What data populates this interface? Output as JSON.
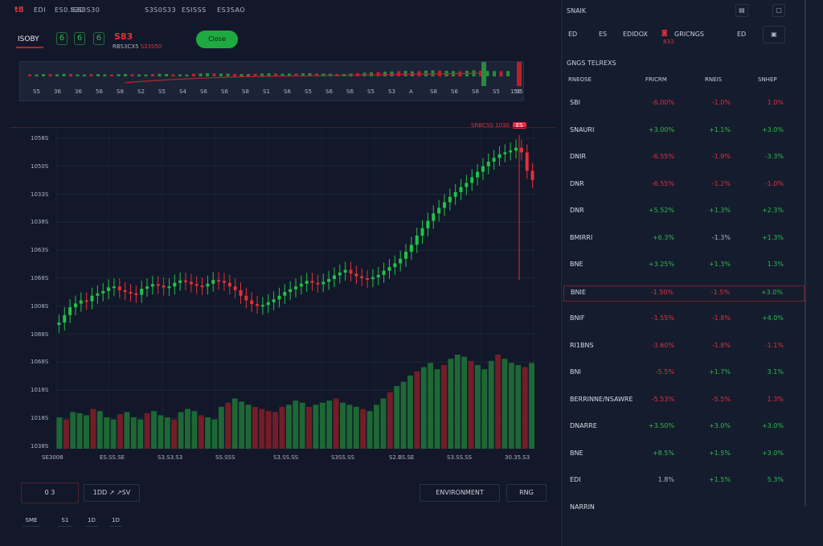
{
  "topbar": {
    "logo": "t8",
    "menu": [
      "EDI",
      "ES0.S30",
      "ISS3S30",
      "S3S0S33",
      "ESISSS",
      "ES3SAO"
    ]
  },
  "ticker": {
    "symbol": "ISOBY",
    "chips": [
      "6",
      "6",
      "6"
    ],
    "price": "S83",
    "sub_a": "RBS3CX5",
    "sub_b": "S33S50",
    "green_button": "Close"
  },
  "navigator": {
    "ticks": [
      "S5",
      "36",
      "36",
      "56",
      "S8",
      "S2",
      "S5",
      "S4",
      "S6",
      "S6",
      "S8",
      "S1",
      "S6",
      "S5",
      "S6",
      "S6",
      "S5",
      "S3",
      "A",
      "S8",
      "S6",
      "S8",
      "S5",
      "50"
    ],
    "end_label": "1.05"
  },
  "chart": {
    "live_label": "SRBCSS 1030",
    "live_badge": "ES",
    "y_labels": [
      "1058S",
      "1050S",
      "1033S",
      "1038S",
      "1063S",
      "1068S",
      "1008S",
      "1088S",
      "1068S",
      "1018S",
      "1018S",
      "1038S"
    ],
    "x_labels": [
      "SE3008",
      "ES.SS.SE",
      "S3.S3.S3",
      "SS.SSS",
      "S3.SS.SS",
      "S3SS.SS",
      "S2.BS.SE",
      "S3.SS.SS",
      "30.35.S3"
    ]
  },
  "chart_data": {
    "type": "candlestick",
    "series": [
      {
        "name": "price",
        "values": [
          392,
          408,
          425,
          433,
          440,
          438,
          450,
          455,
          460,
          468,
          470,
          462,
          458,
          455,
          452,
          465,
          470,
          475,
          472,
          468,
          470,
          478,
          483,
          480,
          475,
          472,
          470,
          476,
          484,
          482,
          478,
          470,
          462,
          450,
          440,
          432,
          428,
          430,
          436,
          442,
          450,
          458,
          464,
          470,
          476,
          482,
          478,
          475,
          480,
          486,
          494,
          500,
          506,
          498,
          492,
          488,
          486,
          490,
          495,
          504,
          512,
          520,
          530,
          545,
          560,
          580,
          596,
          612,
          628,
          640,
          652,
          664,
          674,
          685,
          694,
          706,
          718,
          730,
          740,
          748,
          756,
          760,
          764,
          770,
          760,
          720,
          700
        ]
      }
    ],
    "volume": [
      30,
      28,
      35,
      34,
      32,
      38,
      36,
      30,
      28,
      33,
      35,
      30,
      28,
      34,
      36,
      32,
      30,
      28,
      35,
      38,
      36,
      32,
      30,
      28,
      40,
      44,
      48,
      45,
      42,
      40,
      38,
      36,
      35,
      40,
      42,
      46,
      44,
      40,
      42,
      44,
      46,
      48,
      44,
      42,
      40,
      38,
      36,
      42,
      48,
      54,
      60,
      64,
      70,
      74,
      78,
      82,
      76,
      80,
      86,
      90,
      88,
      84,
      80,
      76,
      84,
      90,
      86,
      82,
      80,
      78,
      82
    ]
  },
  "controls": {
    "left_box": "0   3",
    "range_box": "1DD ↗ ↗SV",
    "tabs": [
      "SME",
      "S1",
      "1D",
      "1D"
    ],
    "right_wide": "ENVIRONMENT",
    "right_small": "RNG"
  },
  "sidebar": {
    "top_label": "SNAIK",
    "filters": [
      "ED",
      "ES",
      "EDIDOX"
    ],
    "badge_label": "GRICNGS",
    "badge_sub": "833",
    "extra": "ED",
    "section": "GNGS TELREXS",
    "cols": [
      "RNEOSE",
      "FRICRM",
      "RNEIS",
      "SNHEP"
    ],
    "rows": [
      {
        "n": "SBI",
        "p": "-6.00%",
        "c": "-1.0%",
        "v": "1.0%",
        "pc": "red",
        "cc": "red",
        "vc": "red"
      },
      {
        "n": "SNAURI",
        "p": "+3.00%",
        "c": "+1.1%",
        "v": "+3.0%",
        "pc": "green",
        "cc": "green",
        "vc": "green"
      },
      {
        "n": "DNIR",
        "p": "-6.55%",
        "c": "-1.9%",
        "v": "-3.3%",
        "pc": "red",
        "cc": "red",
        "vc": "green"
      },
      {
        "n": "DNR",
        "p": "-6.55%",
        "c": "-1.2%",
        "v": "-1.0%",
        "pc": "red",
        "cc": "red",
        "vc": "red"
      },
      {
        "n": "DNR",
        "p": "+5.52%",
        "c": "+1.3%",
        "v": "+2.3%",
        "pc": "green",
        "cc": "green",
        "vc": "green"
      },
      {
        "n": "BMIRRI",
        "p": "+6.3%",
        "c": "-1.3%",
        "v": "+1.3%",
        "pc": "green",
        "cc": "dim",
        "vc": "green"
      },
      {
        "n": "BNE",
        "p": "+3.25%",
        "c": "+1.3%",
        "v": "1.3%",
        "pc": "green",
        "cc": "green",
        "vc": "green"
      },
      {
        "n": "BNIE",
        "p": "-1.50%",
        "c": "-1.5%",
        "v": "+3.0%",
        "pc": "red",
        "cc": "red",
        "vc": "green"
      },
      {
        "n": "BNIF",
        "p": "-1.55%",
        "c": "-1.8%",
        "v": "+4.0%",
        "pc": "red",
        "cc": "red",
        "vc": "green"
      },
      {
        "n": "RI1BNS",
        "p": "-3.60%",
        "c": "-1.8%",
        "v": "-1.1%",
        "pc": "red",
        "cc": "red",
        "vc": "red"
      },
      {
        "n": "BNI",
        "p": "-5.5%",
        "c": "+1.7%",
        "v": "3.1%",
        "pc": "red",
        "cc": "green",
        "vc": "green"
      },
      {
        "n": "BERRINNE/NSAWRE",
        "p": "-5.53%",
        "c": "-5.5%",
        "v": "1.3%",
        "pc": "red",
        "cc": "red",
        "vc": "red"
      },
      {
        "n": "DNARRE",
        "p": "+3.50%",
        "c": "+3.0%",
        "v": "+3.0%",
        "pc": "green",
        "cc": "green",
        "vc": "green"
      },
      {
        "n": "BNE",
        "p": "+8.5%",
        "c": "+1.5%",
        "v": "+3.0%",
        "pc": "green",
        "cc": "green",
        "vc": "green"
      },
      {
        "n": "EDI",
        "p": "1.8%",
        "c": "+1.5%",
        "v": "5.3%",
        "pc": "dim",
        "cc": "green",
        "vc": "green"
      },
      {
        "n": "NARRIN",
        "p": "",
        "c": "",
        "v": "",
        "pc": "dim",
        "cc": "dim",
        "vc": "dim"
      }
    ]
  }
}
